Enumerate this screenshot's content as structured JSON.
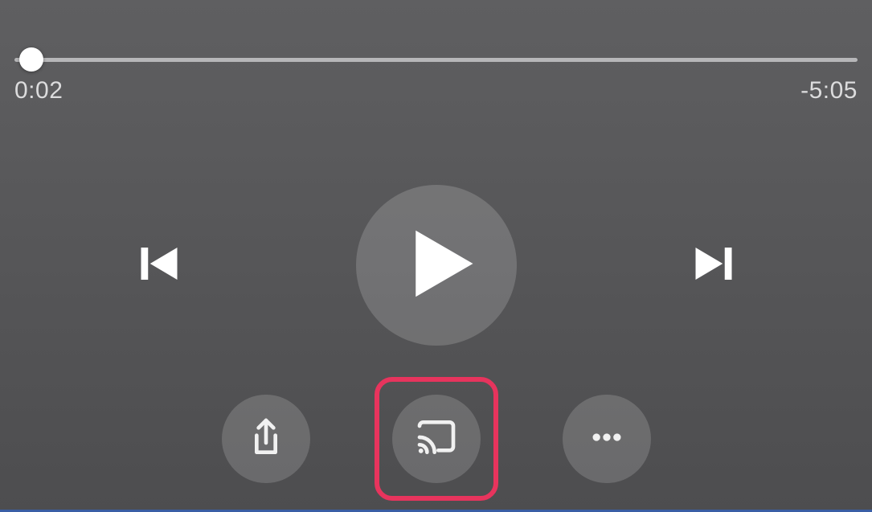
{
  "progress": {
    "elapsed": "0:02",
    "remaining": "-5:05"
  },
  "highlight": {
    "target": "cast-button",
    "color": "#e7345d"
  }
}
